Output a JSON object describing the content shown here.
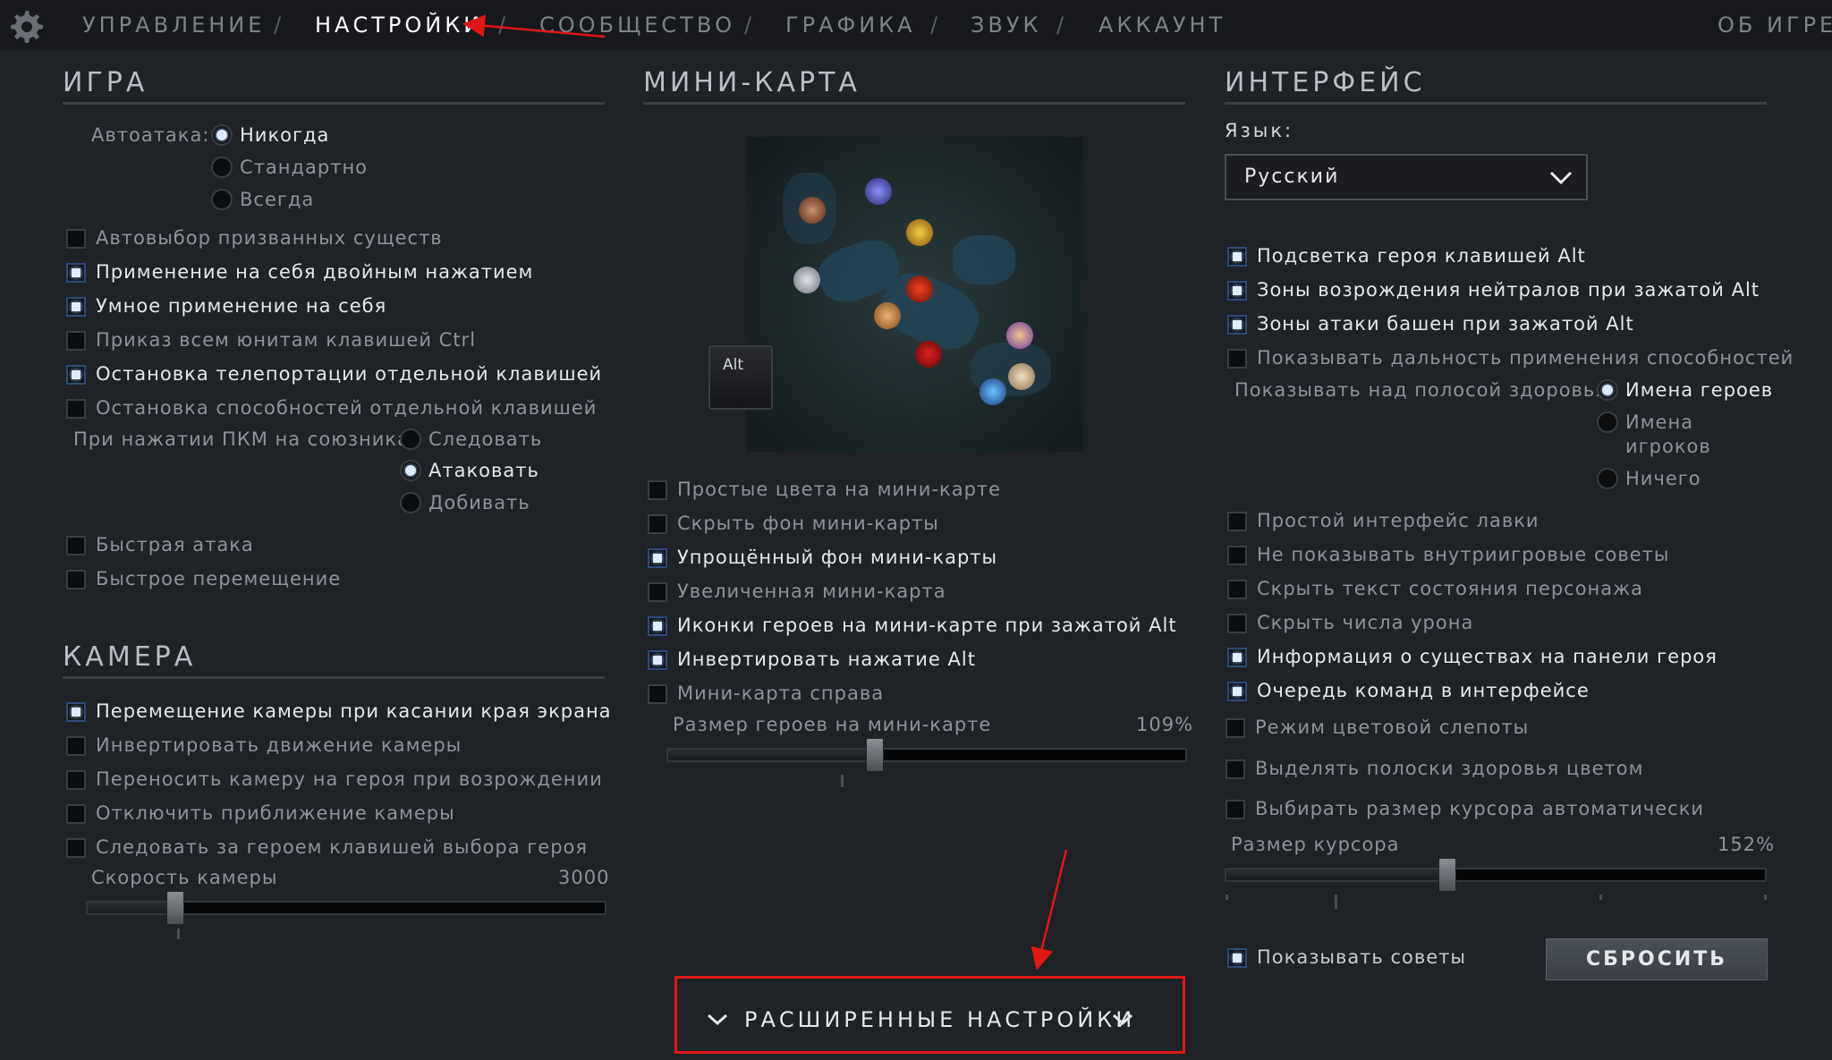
{
  "nav": {
    "items": [
      "УПРАВЛЕНИЕ",
      "НАСТРОЙКИ",
      "СООБЩЕСТВО",
      "ГРАФИКА",
      "ЗВУК",
      "АККАУНТ"
    ],
    "separator": "/",
    "about": "ОБ ИГРЕ",
    "active": "НАСТРОЙКИ"
  },
  "game": {
    "title": "ИГРА",
    "autoattack_label": "Автоатака:",
    "autoattack_options": [
      "Никогда",
      "Стандартно",
      "Всегда"
    ],
    "autoattack_selected": "Никогда",
    "checks1": [
      {
        "label": "Автовыбор призванных существ",
        "checked": false
      },
      {
        "label": "Применение на себя двойным нажатием",
        "checked": true
      },
      {
        "label": "Умное применение на себя",
        "checked": true
      },
      {
        "label": "Приказ всем юнитам клавишей Ctrl",
        "checked": false
      },
      {
        "label": "Остановка телепортации отдельной клавишей",
        "checked": true
      },
      {
        "label": "Остановка способностей отдельной клавишей",
        "checked": false
      }
    ],
    "ally_label": "При нажатии ПКМ на союзника",
    "ally_options": [
      "Следовать",
      "Атаковать",
      "Добивать"
    ],
    "ally_selected": "Атаковать",
    "checks2": [
      {
        "label": "Быстрая атака",
        "checked": false
      },
      {
        "label": "Быстрое перемещение",
        "checked": false
      }
    ]
  },
  "camera": {
    "title": "КАМЕРА",
    "checks": [
      {
        "label": "Перемещение камеры при касании края экрана",
        "checked": true
      },
      {
        "label": "Инвертировать движение камеры",
        "checked": false
      },
      {
        "label": "Переносить камеру на героя при возрождении",
        "checked": false
      },
      {
        "label": "Отключить приближение камеры",
        "checked": false
      },
      {
        "label": "Следовать за героем клавишей выбора героя",
        "checked": false
      }
    ],
    "speed_label": "Скорость камеры",
    "speed_value": "3000",
    "speed_fraction": 0.17
  },
  "minimap": {
    "title": "МИНИ-КАРТА",
    "alt_key": "Alt",
    "checks": [
      {
        "label": "Простые цвета на мини-карте",
        "checked": false
      },
      {
        "label": "Скрыть фон мини-карты",
        "checked": false
      },
      {
        "label": "Упрощённый фон мини-карты",
        "checked": true
      },
      {
        "label": "Увеличенная мини-карта",
        "checked": false
      },
      {
        "label": "Иконки героев на мини-карте при зажатой Alt",
        "checked": true
      },
      {
        "label": "Инвертировать нажатие Alt",
        "checked": true
      },
      {
        "label": "Мини-карта справа",
        "checked": false
      }
    ],
    "hero_size_label": "Размер героев на мини-карте",
    "hero_size_value": "109%",
    "hero_size_fraction": 0.4
  },
  "interface": {
    "title": "ИНТЕРФЕЙС",
    "language_label": "Язык:",
    "language_value": "Русский",
    "checks1": [
      {
        "label": "Подсветка героя клавишей Alt",
        "checked": true
      },
      {
        "label": "Зоны возрождения нейтралов при зажатой Alt",
        "checked": true
      },
      {
        "label": "Зоны атаки башен при зажатой Alt",
        "checked": true
      },
      {
        "label": "Показывать дальность применения способностей",
        "checked": false
      }
    ],
    "health_label": "Показывать над полосой здоровья:",
    "health_options": [
      "Имена героев",
      "Имена игроков",
      "Ничего"
    ],
    "health_option2_lines": [
      "Имена",
      "игроков"
    ],
    "health_selected": "Имена героев",
    "checks2": [
      {
        "label": "Простой интерфейс лавки",
        "checked": false
      },
      {
        "label": "Не показывать внутриигровые советы",
        "checked": false
      },
      {
        "label": "Скрыть текст состояния персонажа",
        "checked": false
      },
      {
        "label": "Скрыть числа урона",
        "checked": false
      },
      {
        "label": "Информация о существах на панели героя",
        "checked": true
      },
      {
        "label": "Очередь команд в интерфейсе",
        "checked": true
      },
      {
        "label": "Режим цветовой слепоты",
        "checked": false
      },
      {
        "label": "Выделять полоски здоровья цветом",
        "checked": false
      },
      {
        "label": "Выбирать размер курсора автоматически",
        "checked": false
      }
    ],
    "cursor_label": "Размер курсора",
    "cursor_value": "152%",
    "cursor_fraction": 0.41,
    "tips_label": "Показывать советы",
    "tips_checked": true,
    "reset_label": "СБРОСИТЬ"
  },
  "advanced": {
    "label": "РАСШИРЕННЫЕ НАСТРОЙКИ"
  },
  "colors": {
    "annotation": "#e01818",
    "check_glow": "#e0ecff"
  }
}
